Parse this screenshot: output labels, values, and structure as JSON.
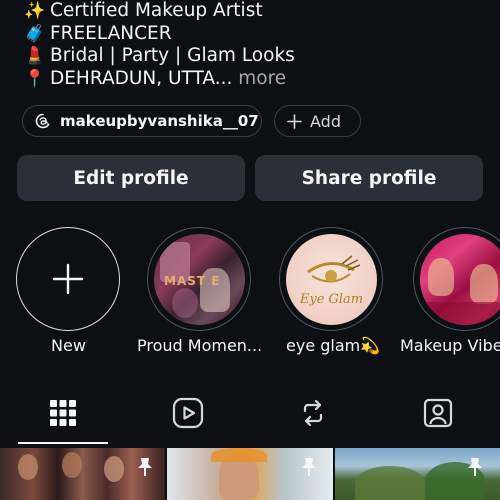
{
  "bio": {
    "lines": [
      {
        "emoji": "✨",
        "text": "Certified Makeup Artist"
      },
      {
        "emoji": "🧳",
        "text": "FREELANCER"
      },
      {
        "emoji": "💄",
        "text": "Bridal | Party | Glam Looks"
      },
      {
        "emoji": "📍",
        "text": "DEHRADUN, UTTA..."
      }
    ],
    "more_label": "more"
  },
  "threads_badge": {
    "icon": "threads-icon",
    "handle": "makeupbyvanshika__07"
  },
  "add_badge": {
    "icon": "plus-icon",
    "label": "Add"
  },
  "buttons": {
    "edit_profile": "Edit profile",
    "share_profile": "Share profile"
  },
  "highlights": [
    {
      "label": "New",
      "icon": "plus-icon"
    },
    {
      "label": "Proud Momen...",
      "cover_text": "MAST E"
    },
    {
      "label": "eye glam💫",
      "cover_text": "Eye Glam"
    },
    {
      "label": "Makeup Vibe"
    }
  ],
  "tabs": [
    {
      "name": "posts",
      "icon": "grid-icon",
      "selected": true
    },
    {
      "name": "reels",
      "icon": "reels-icon",
      "selected": false
    },
    {
      "name": "reposts",
      "icon": "repost-icon",
      "selected": false
    },
    {
      "name": "tagged",
      "icon": "tagged-person-icon",
      "selected": false
    }
  ],
  "grid_posts": [
    {
      "pinned": true,
      "icon": "pin-icon"
    },
    {
      "pinned": true,
      "icon": "pin-icon"
    },
    {
      "pinned": true,
      "icon": "pin-icon"
    }
  ],
  "colors": {
    "background": "#0c0f14",
    "button_bg": "#2a2f38",
    "text": "#f5f5f5",
    "muted": "#a8a8a8",
    "outline": "#3a3d44"
  }
}
